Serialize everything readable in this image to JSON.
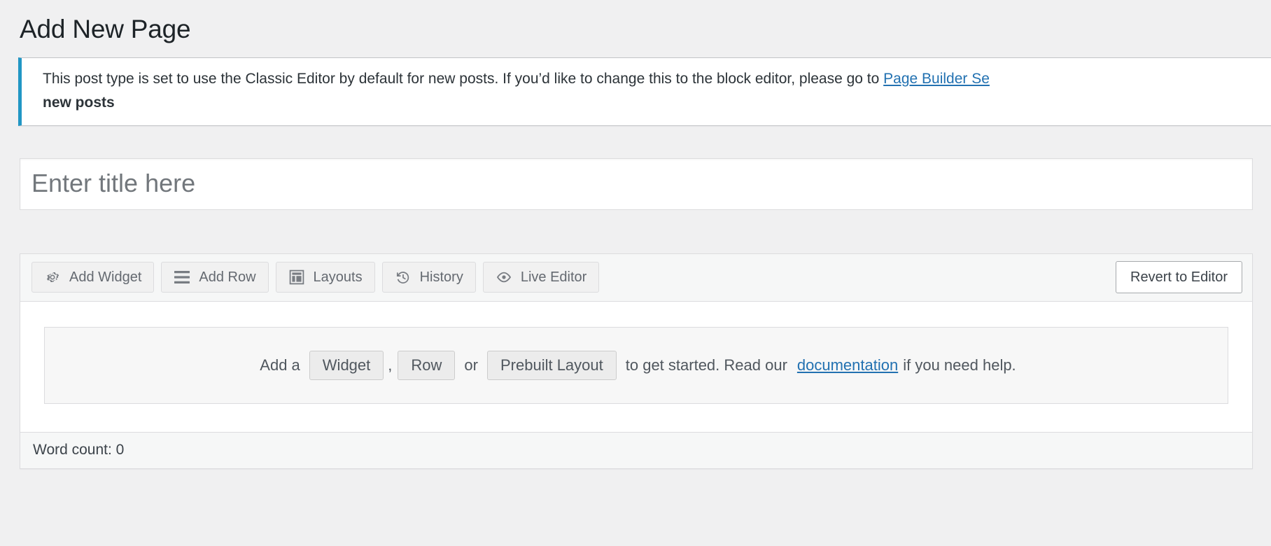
{
  "page": {
    "title": "Add New Page"
  },
  "notice": {
    "text_before_link": "This post type is set to use the Classic Editor by default for new posts. If you’d like to change this to the block editor, please go to ",
    "link_label": "Page Builder Se",
    "line2": "new posts",
    "accent_color": "#2196c4",
    "link_color": "#2271b1"
  },
  "title_field": {
    "placeholder": "Enter title here",
    "value": ""
  },
  "builder": {
    "toolbar": {
      "buttons": [
        {
          "label": "Add Widget",
          "icon": "gear-icon"
        },
        {
          "label": "Add Row",
          "icon": "rows-icon"
        },
        {
          "label": "Layouts",
          "icon": "layout-icon"
        },
        {
          "label": "History",
          "icon": "history-icon"
        },
        {
          "label": "Live Editor",
          "icon": "eye-icon"
        }
      ],
      "revert_label": "Revert to Editor"
    },
    "empty_state": {
      "prefix": "Add a",
      "widget_label": "Widget",
      "comma": ",",
      "row_label": "Row",
      "or_label": "or",
      "prebuilt_label": "Prebuilt Layout",
      "middle": "to get started. Read our",
      "doc_label": "documentation",
      "suffix": "if you need help."
    },
    "footer": {
      "word_count": "Word count: 0"
    }
  }
}
